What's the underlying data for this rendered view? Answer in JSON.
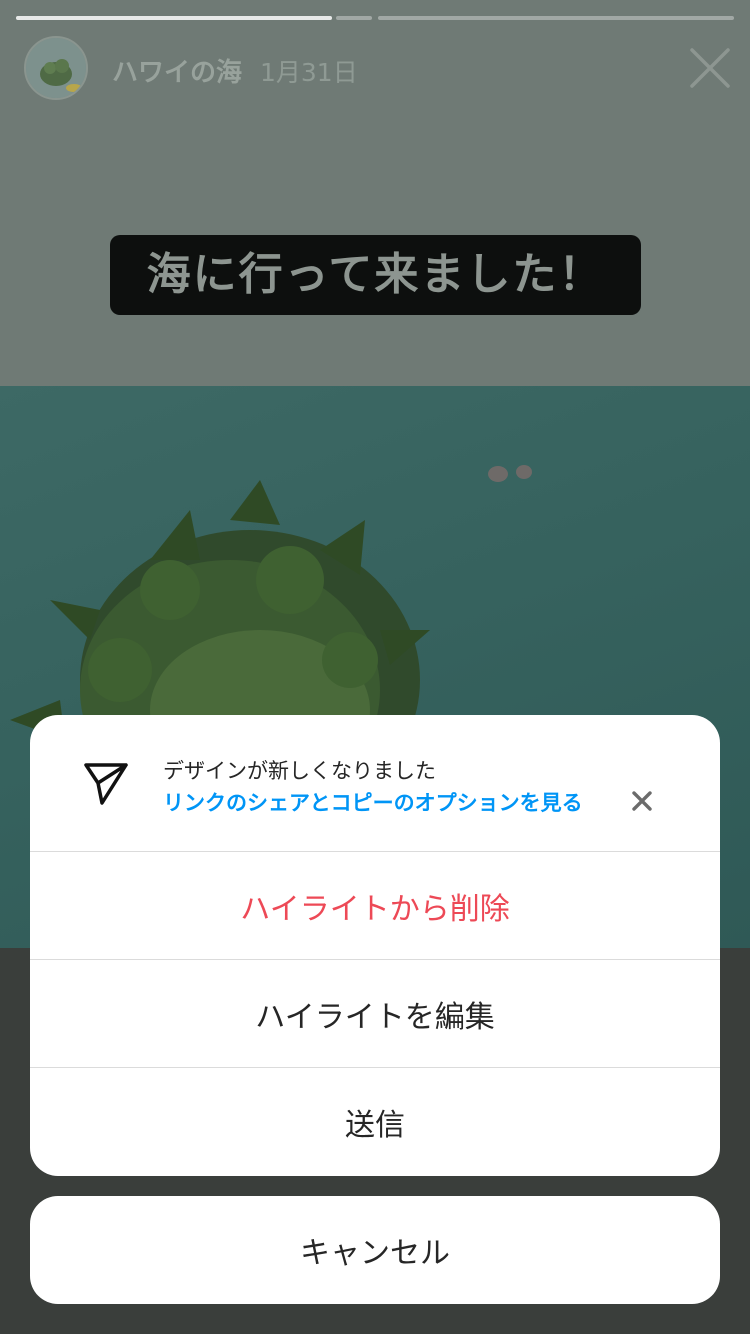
{
  "story": {
    "user_name": "ハワイの海",
    "date": "1月31日",
    "caption": "海に行って来ました！",
    "progress_fractions": [
      1.0,
      0.0
    ]
  },
  "icons": {
    "avatar": "avatar-image",
    "close": "close-icon",
    "send": "paper-plane-icon",
    "notice_close": "close-icon"
  },
  "sheet": {
    "notice_title": "デザインが新しくなりました",
    "notice_link": "リンクのシェアとコピーのオプションを見る",
    "remove_from_highlight": "ハイライトから削除",
    "edit_highlight": "ハイライトを編集",
    "send": "送信",
    "cancel": "キャンセル"
  },
  "colors": {
    "danger": "#ed4956",
    "link": "#0095f6",
    "text": "#262626"
  }
}
